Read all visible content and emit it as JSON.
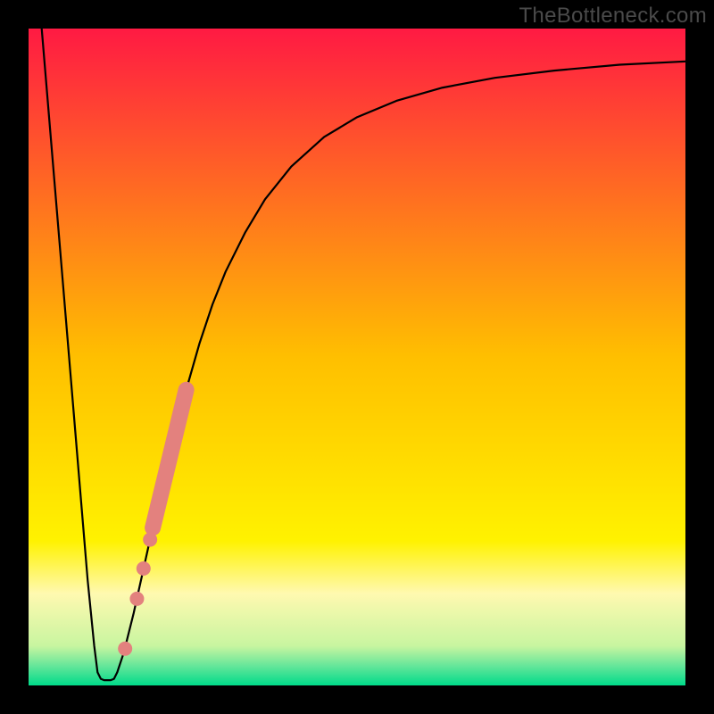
{
  "watermark": "TheBottleneck.com",
  "chart_data": {
    "type": "line",
    "title": "",
    "xlabel": "",
    "ylabel": "",
    "xlim": [
      0,
      100
    ],
    "ylim": [
      0,
      100
    ],
    "grid": false,
    "axis_visible": false,
    "background": {
      "type": "vertical_gradient",
      "stops": [
        {
          "offset": 0.0,
          "color": "#ff1a43"
        },
        {
          "offset": 0.5,
          "color": "#ffbf00"
        },
        {
          "offset": 0.78,
          "color": "#fff200"
        },
        {
          "offset": 0.86,
          "color": "#fff9b0"
        },
        {
          "offset": 0.94,
          "color": "#c8f5a0"
        },
        {
          "offset": 0.97,
          "color": "#66e69a"
        },
        {
          "offset": 1.0,
          "color": "#00db8a"
        }
      ]
    },
    "series": [
      {
        "name": "bottleneck-curve",
        "type": "line",
        "color": "#000000",
        "width": 2.2,
        "points": [
          {
            "x": 2.0,
            "y": 100.0
          },
          {
            "x": 3.0,
            "y": 88.0
          },
          {
            "x": 4.0,
            "y": 76.0
          },
          {
            "x": 5.0,
            "y": 64.0
          },
          {
            "x": 6.0,
            "y": 52.0
          },
          {
            "x": 7.0,
            "y": 40.0
          },
          {
            "x": 8.0,
            "y": 28.0
          },
          {
            "x": 9.0,
            "y": 16.0
          },
          {
            "x": 10.0,
            "y": 6.0
          },
          {
            "x": 10.5,
            "y": 2.0
          },
          {
            "x": 11.0,
            "y": 1.0
          },
          {
            "x": 11.5,
            "y": 0.8
          },
          {
            "x": 12.5,
            "y": 0.8
          },
          {
            "x": 13.0,
            "y": 1.0
          },
          {
            "x": 13.5,
            "y": 2.0
          },
          {
            "x": 14.5,
            "y": 5.0
          },
          {
            "x": 16.0,
            "y": 11.0
          },
          {
            "x": 18.0,
            "y": 20.0
          },
          {
            "x": 20.0,
            "y": 29.0
          },
          {
            "x": 22.0,
            "y": 37.5
          },
          {
            "x": 24.0,
            "y": 45.0
          },
          {
            "x": 26.0,
            "y": 52.0
          },
          {
            "x": 28.0,
            "y": 58.0
          },
          {
            "x": 30.0,
            "y": 63.0
          },
          {
            "x": 33.0,
            "y": 69.0
          },
          {
            "x": 36.0,
            "y": 74.0
          },
          {
            "x": 40.0,
            "y": 79.0
          },
          {
            "x": 45.0,
            "y": 83.5
          },
          {
            "x": 50.0,
            "y": 86.5
          },
          {
            "x": 56.0,
            "y": 89.0
          },
          {
            "x": 63.0,
            "y": 91.0
          },
          {
            "x": 71.0,
            "y": 92.5
          },
          {
            "x": 80.0,
            "y": 93.6
          },
          {
            "x": 90.0,
            "y": 94.5
          },
          {
            "x": 100.0,
            "y": 95.0
          }
        ]
      },
      {
        "name": "tested-dots",
        "type": "scatter",
        "color": "#e3817e",
        "radius": 8,
        "points": [
          {
            "x": 14.7,
            "y": 5.6
          },
          {
            "x": 16.5,
            "y": 13.2
          },
          {
            "x": 17.5,
            "y": 17.8
          },
          {
            "x": 18.5,
            "y": 22.2
          }
        ]
      },
      {
        "name": "tested-band",
        "type": "thick-line",
        "color": "#e3817e",
        "width": 18,
        "points": [
          {
            "x": 18.9,
            "y": 24.0
          },
          {
            "x": 24.0,
            "y": 45.0
          }
        ]
      }
    ]
  }
}
